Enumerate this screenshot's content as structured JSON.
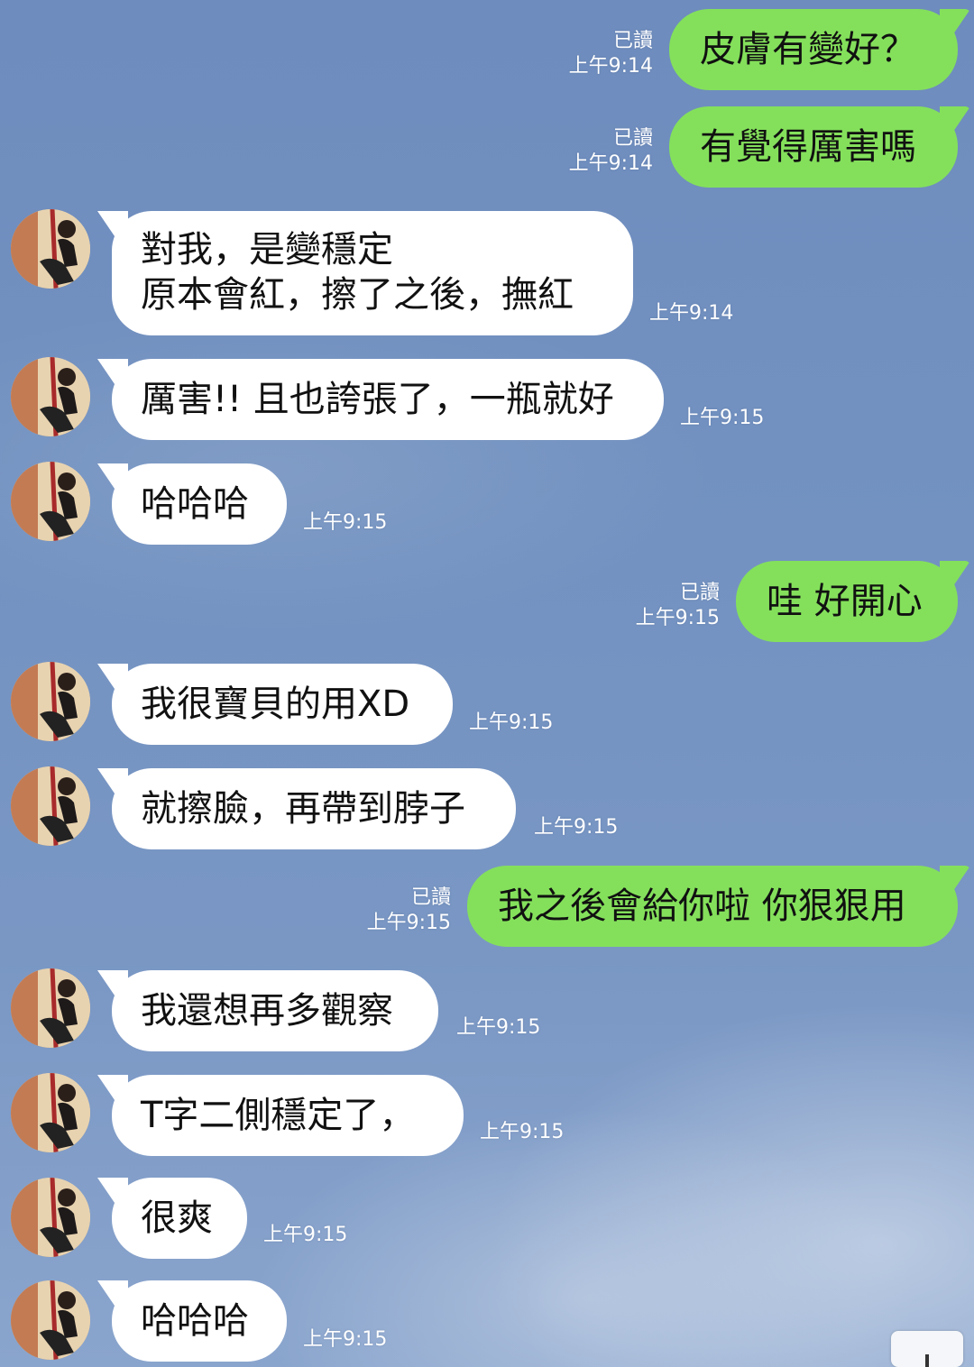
{
  "messages": [
    {
      "side": "out",
      "text": "皮膚有變好？",
      "read": "已讀",
      "time": "上午9:14"
    },
    {
      "side": "out",
      "text": "有覺得厲害嗎",
      "read": "已讀",
      "time": "上午9:14"
    },
    {
      "side": "in",
      "text_lines": [
        "對我，是變穩定",
        "原本會紅，擦了之後，撫紅"
      ],
      "time": "上午9:14"
    },
    {
      "side": "in",
      "text": "厲害!! 且也誇張了，一瓶就好",
      "time": "上午9:15"
    },
    {
      "side": "in",
      "text": "哈哈哈",
      "time": "上午9:15"
    },
    {
      "side": "out",
      "text": "哇 好開心",
      "read": "已讀",
      "time": "上午9:15"
    },
    {
      "side": "in",
      "text": "我很寶貝的用XD",
      "time": "上午9:15"
    },
    {
      "side": "in",
      "text": "就擦臉，再帶到脖子",
      "time": "上午9:15"
    },
    {
      "side": "out",
      "text": "我之後會給你啦 你狠狠用",
      "read": "已讀",
      "time": "上午9:15"
    },
    {
      "side": "in",
      "text": "我還想再多觀察",
      "time": "上午9:15"
    },
    {
      "side": "in",
      "text": "T字二側穩定了，",
      "time": "上午9:15"
    },
    {
      "side": "in",
      "text": "很爽",
      "time": "上午9:15"
    },
    {
      "side": "in",
      "text": "哈哈哈",
      "time": "上午9:15"
    }
  ],
  "colors": {
    "outgoing_bubble": "#84e05b",
    "incoming_bubble": "#ffffff",
    "background": "#7392c1"
  },
  "icons": {
    "avatar": "contact-avatar-photo",
    "scroll_button": "scroll-down-arrow-icon"
  }
}
